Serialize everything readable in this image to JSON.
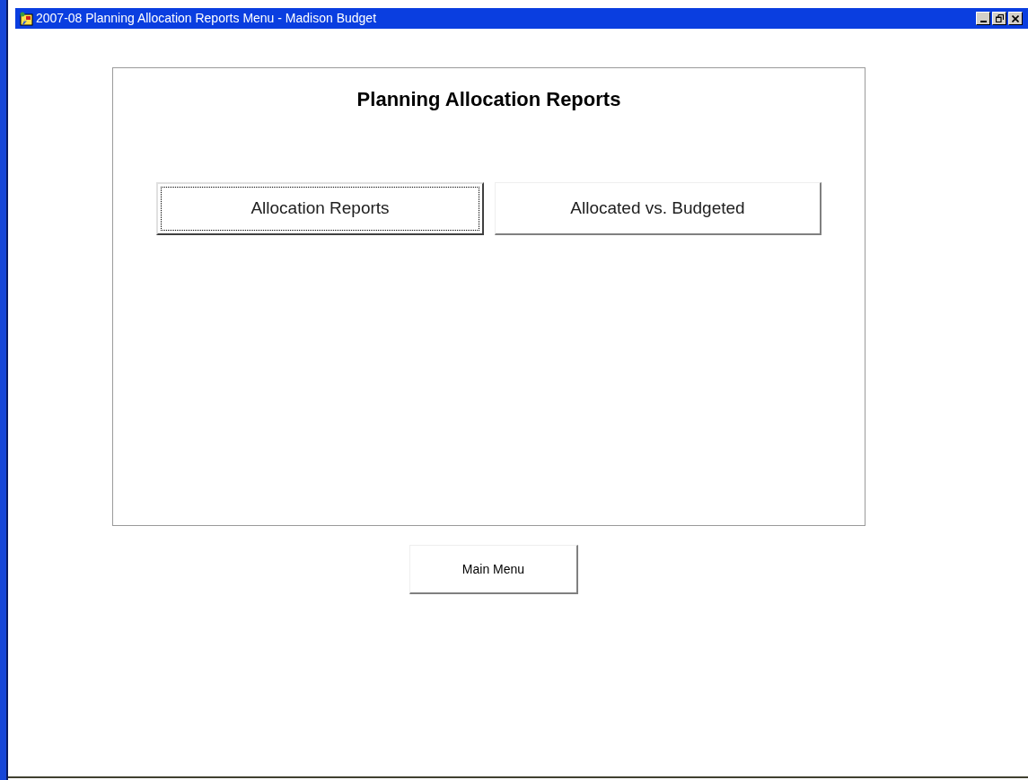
{
  "window": {
    "title": "2007-08 Planning Allocation Reports Menu - Madison Budget"
  },
  "panel": {
    "title": "Planning Allocation Reports",
    "buttons": [
      {
        "label": "Allocation Reports",
        "focused": true
      },
      {
        "label": "Allocated vs. Budgeted",
        "focused": false
      }
    ]
  },
  "footer_button": {
    "label": "Main Menu"
  }
}
